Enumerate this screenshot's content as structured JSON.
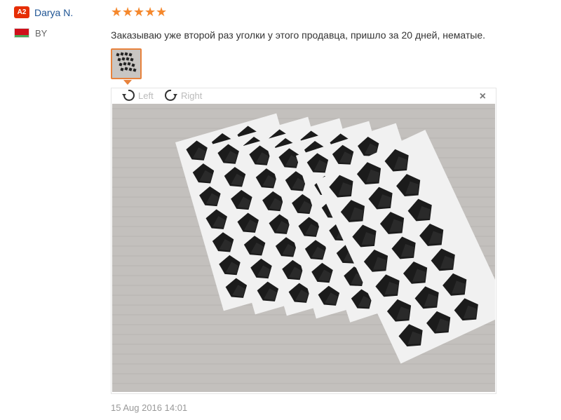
{
  "user": {
    "badge": "A2",
    "name": "Darya N.",
    "country": "BY",
    "flag_colors": {
      "top": "#cf101a",
      "bottom": "#4aa657"
    }
  },
  "rating": {
    "stars": 5,
    "max": 5,
    "color": "#f5882d"
  },
  "review": {
    "text": "Заказываю уже второй раз уголки у этого продавца, пришло за 20 дней, нематые.",
    "timestamp": "15 Aug 2016 14:01"
  },
  "viewer": {
    "rotate_left_label": "Left",
    "rotate_right_label": "Right",
    "close_icon": "close-icon",
    "thumbnail_count": 1,
    "accent": "#e8823c"
  },
  "colors": {
    "link": "#1e5494",
    "badge": "#e62e04",
    "muted": "#999999"
  }
}
